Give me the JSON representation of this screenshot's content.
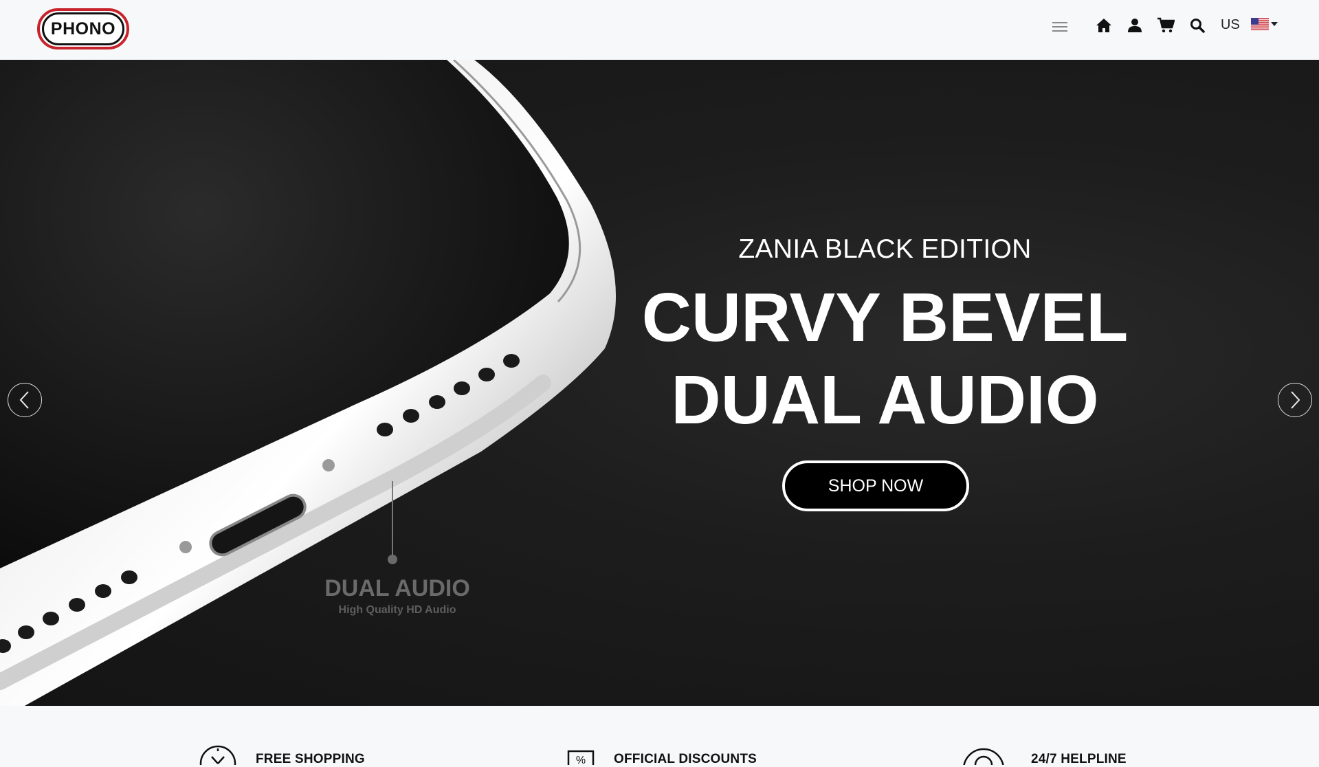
{
  "header": {
    "logo_text": "PHONO",
    "locale": "US",
    "icons": [
      "menu-icon",
      "home-icon",
      "user-icon",
      "cart-icon",
      "search-icon",
      "us-flag-icon"
    ]
  },
  "hero": {
    "subtitle": "ZANIA BLACK EDITION",
    "title_line1": "CURVY BEVEL",
    "title_line2": "DUAL AUDIO",
    "cta_label": "SHOP NOW",
    "callout_title": "DUAL AUDIO",
    "callout_subtitle": "High Quality HD Audio"
  },
  "features": [
    {
      "label": "FREE SHOPPING",
      "icon": "delivery-clock-icon"
    },
    {
      "label": "OFFICIAL DISCOUNTS",
      "icon": "percent-tag-icon"
    },
    {
      "label": "24/7 HELPLINE",
      "icon": "support-icon"
    }
  ],
  "colors": {
    "brand_red": "#c8232c",
    "hero_bg": "#1a1a1a",
    "header_bg": "#f7f8f9"
  }
}
